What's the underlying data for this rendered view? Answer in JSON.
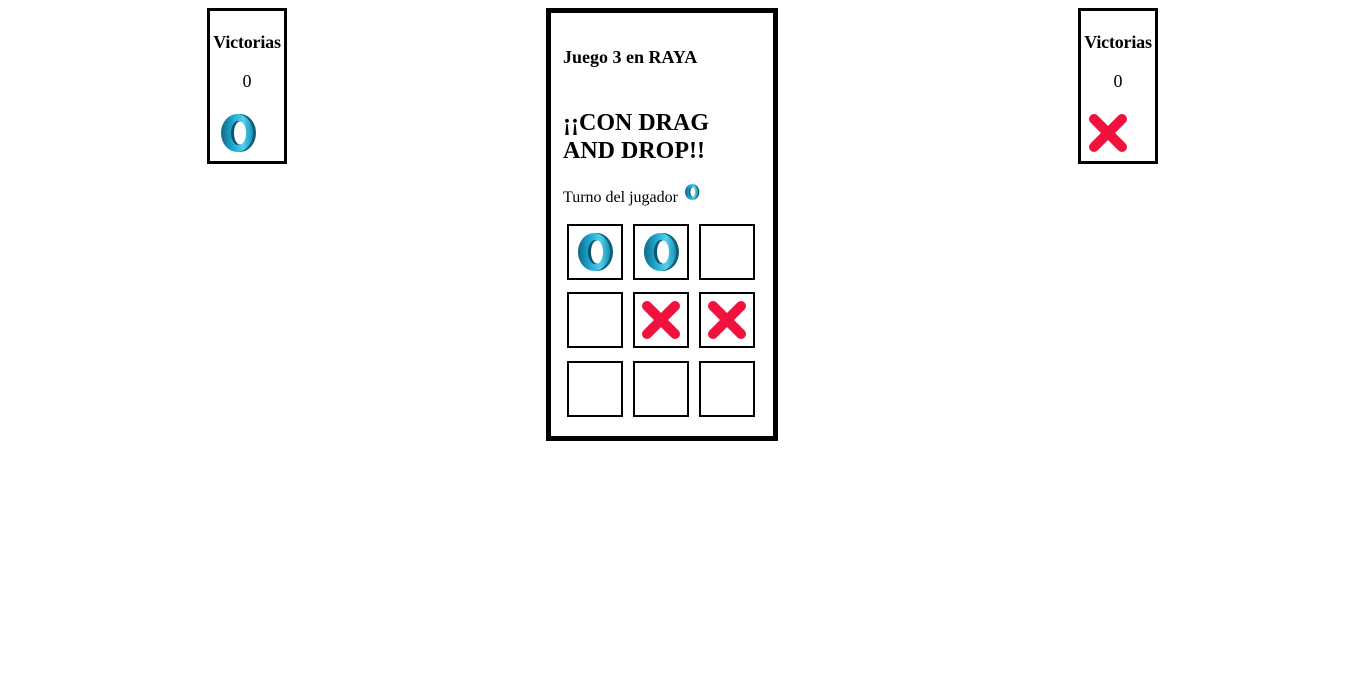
{
  "left_player": {
    "title": "Victorias",
    "wins": "0",
    "piece": "o-piece-icon"
  },
  "right_player": {
    "title": "Victorias",
    "wins": "0",
    "piece": "x-piece-icon"
  },
  "game": {
    "title": "Juego 3 en RAYA",
    "subtitle": "¡¡CON DRAG AND DROP!!",
    "turn_label": "Turno del jugador",
    "turn_piece": "o-piece-icon"
  },
  "board": [
    [
      "O",
      "O",
      ""
    ],
    [
      "",
      "X",
      "X"
    ],
    [
      "",
      "",
      ""
    ]
  ],
  "colors": {
    "o_piece": "#2bb3d6",
    "o_piece_dark": "#0f6f8c",
    "x_piece": "#f0113c",
    "border": "#000000"
  }
}
